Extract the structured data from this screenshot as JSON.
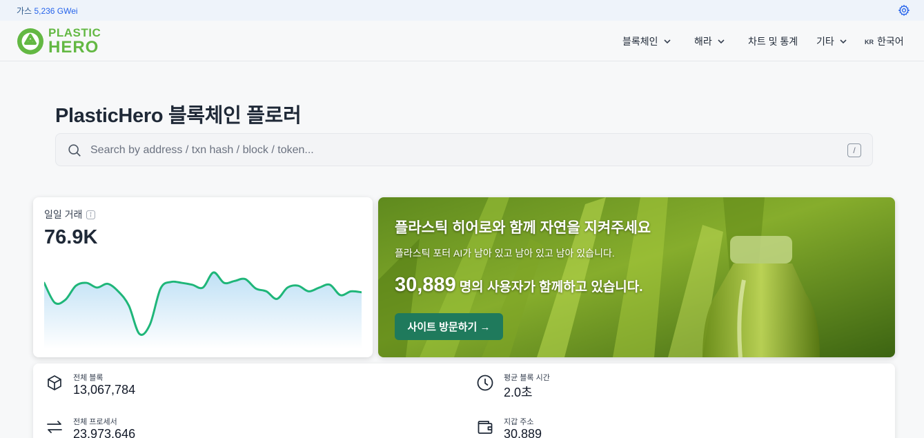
{
  "topbar": {
    "gas_label": "가스",
    "gas_value": "5,236 GWei"
  },
  "logo": {
    "line1": "PLASTIC",
    "line2": "HERO"
  },
  "nav": {
    "blockchain": "블록체인",
    "ecosystem": "해라",
    "charts": "차트 및 통계",
    "other": "기타",
    "lang_code": "KR",
    "lang": "한국어"
  },
  "page": {
    "title": "PlasticHero 블록체인 플로러"
  },
  "search": {
    "placeholder": "Search by address / txn hash / block / token...",
    "shortcut": "/"
  },
  "daily_tx": {
    "label": "일일 거래",
    "value": "76.9K"
  },
  "chart_data": {
    "type": "area",
    "values": [
      58,
      37,
      40,
      55,
      58,
      53,
      57,
      49,
      34,
      4,
      14,
      52,
      59,
      58,
      56,
      53,
      69,
      58,
      60,
      62,
      52,
      49,
      41,
      53,
      55,
      49,
      53,
      56,
      45,
      49,
      48
    ],
    "color": "#1fb679"
  },
  "banner": {
    "title": "플라스틱 히어로와 함께 자연을 지켜주세요",
    "subtitle": "플라스틱 포터 AI가 남아 있고 남아 있고 남아 있습니다.",
    "users_number": "30,889",
    "users_text": "명의 사용자가 함께하고 있습니다.",
    "button": "사이트 방문하기 →"
  },
  "stats": [
    {
      "label": "전체 블록",
      "value": "13,067,784",
      "icon": "cube-icon"
    },
    {
      "label": "평균 블록 시간",
      "value": "2.0초",
      "icon": "clock-icon"
    },
    {
      "label": "전체 프로세서",
      "value": "23,973,646",
      "icon": "transfer-arrows-icon"
    },
    {
      "label": "지갑 주소",
      "value": "30,889",
      "icon": "wallet-icon"
    }
  ],
  "colors": {
    "accent": "#1f7a5c",
    "logo_green": "#63b843",
    "link_blue": "#2563eb"
  }
}
